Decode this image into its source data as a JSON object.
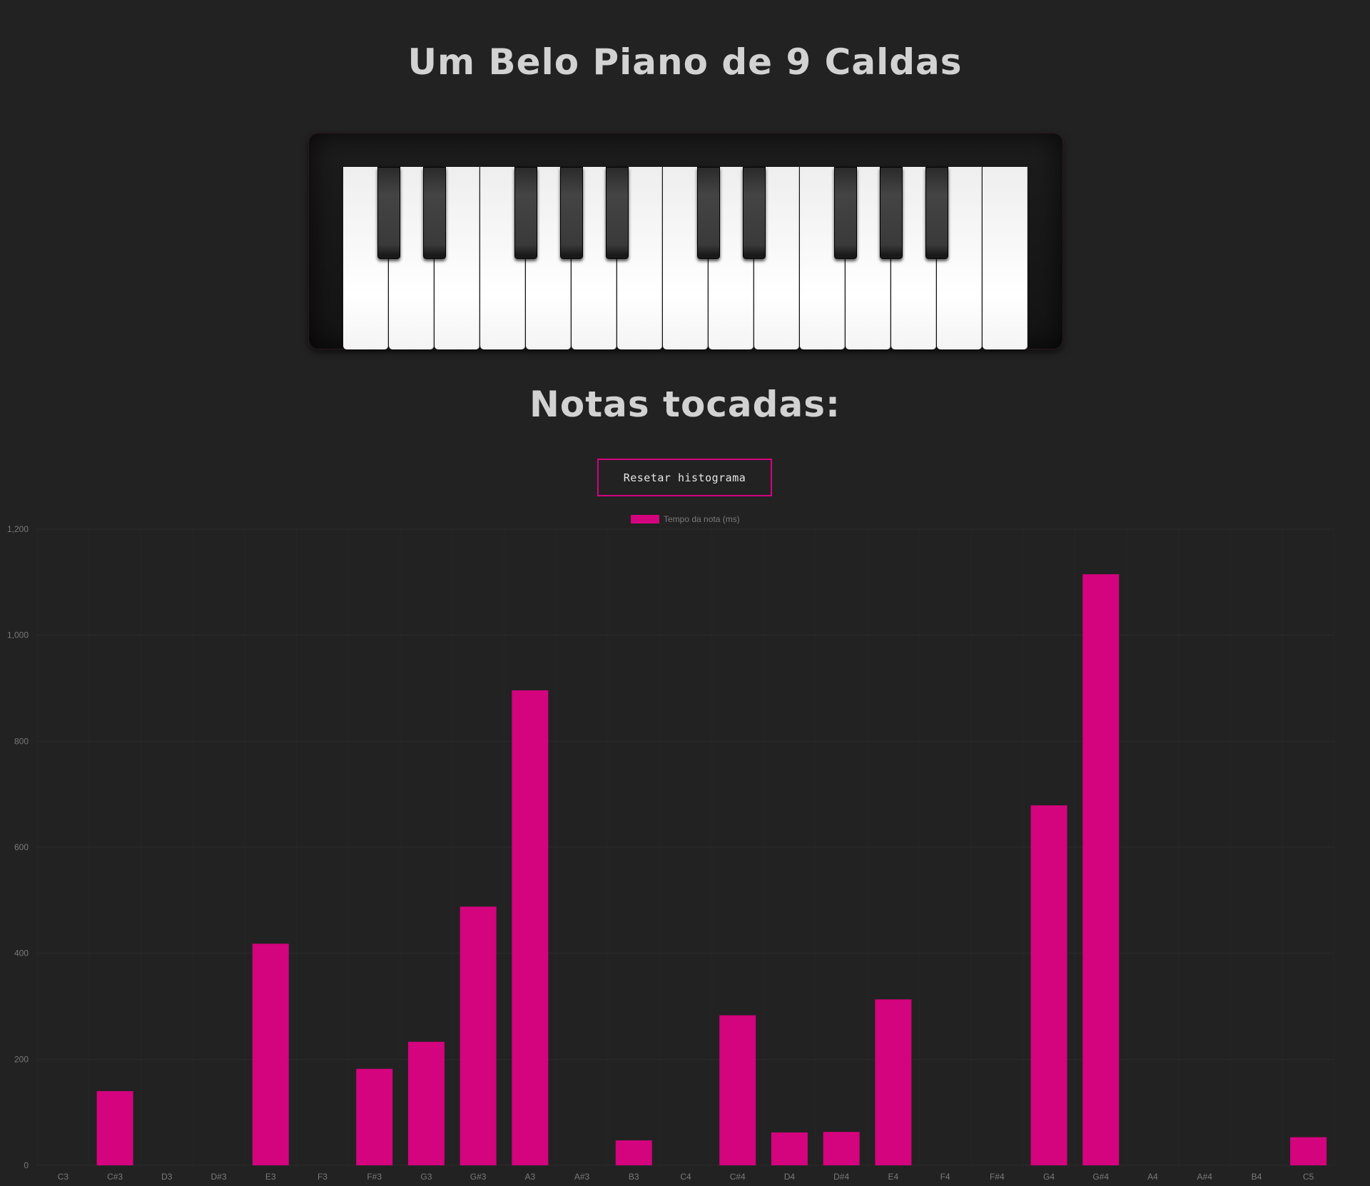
{
  "header": {
    "title": "Um Belo Piano de 9 Caldas"
  },
  "piano": {
    "white_keys": [
      "C3",
      "D3",
      "E3",
      "F3",
      "G3",
      "A3",
      "B3",
      "C4",
      "D4",
      "E4",
      "F4",
      "G4",
      "A4",
      "B4",
      "C5"
    ],
    "black_keys": [
      "C#3",
      "D#3",
      "F#3",
      "G#3",
      "A#3",
      "C#4",
      "D#4",
      "F#4",
      "G#4",
      "A#4"
    ]
  },
  "histogram": {
    "heading": "Notas tocadas:",
    "reset_label": "Resetar histograma"
  },
  "colors": {
    "accent": "#d4037e",
    "background": "#222222",
    "title_text": "#d2d2d2",
    "axis_text": "#7a7a7a"
  },
  "chart_data": {
    "type": "bar",
    "title": "",
    "xlabel": "",
    "ylabel": "",
    "ylim": [
      0,
      1200
    ],
    "yticks": [
      0,
      200,
      400,
      600,
      800,
      1000,
      1200
    ],
    "ytick_labels": [
      "0",
      "200",
      "400",
      "600",
      "800",
      "1,000",
      "1,200"
    ],
    "categories": [
      "C3",
      "C#3",
      "D3",
      "D#3",
      "E3",
      "F3",
      "F#3",
      "G3",
      "G#3",
      "A3",
      "A#3",
      "B3",
      "C4",
      "C#4",
      "D4",
      "D#4",
      "E4",
      "F4",
      "F#4",
      "G4",
      "G#4",
      "A4",
      "A#4",
      "B4",
      "C5"
    ],
    "series": [
      {
        "name": "Tempo da nota (ms)",
        "color": "#d4037e",
        "values": [
          0,
          140,
          0,
          0,
          418,
          0,
          182,
          233,
          488,
          896,
          0,
          47,
          0,
          283,
          62,
          63,
          313,
          0,
          0,
          679,
          1115,
          0,
          0,
          0,
          53
        ]
      }
    ],
    "legend": "top-center",
    "grid": true
  }
}
